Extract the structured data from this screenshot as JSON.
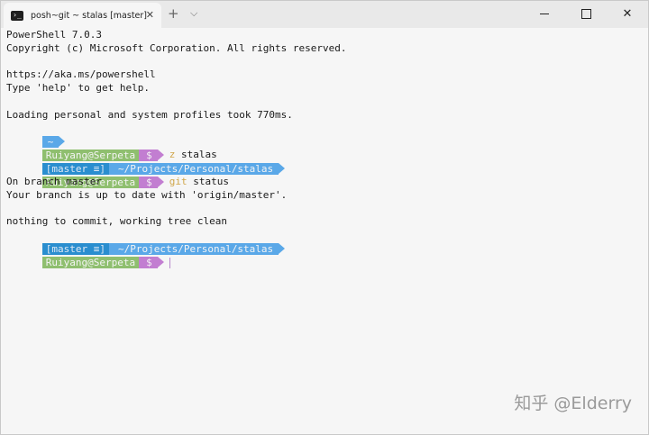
{
  "tab": {
    "icon_glyph": "›_",
    "title": "posh~git ~ stalas [master]",
    "close_glyph": "✕"
  },
  "titlebar": {
    "new_tab_glyph": "+",
    "dropdown_glyph": "⌵",
    "close_glyph": "✕"
  },
  "terminal": {
    "banner": [
      "PowerShell 7.0.3",
      "Copyright (c) Microsoft Corporation. All rights reserved.",
      "",
      "https://aka.ms/powershell",
      "Type 'help' to get help.",
      "",
      "Loading personal and system profiles took 770ms."
    ],
    "tilde_segment": "~",
    "prompt_user": "Ruiyang@Serpeta",
    "prompt_dollar": "$",
    "cmd1_word": "z",
    "cmd1_arg": "stalas",
    "branch_segment": "[master ≡]",
    "path_segment": "~/Projects/Personal/stalas",
    "cmd2_word": "git",
    "cmd2_arg": "status",
    "output": [
      "On branch master",
      "Your branch is up to date with 'origin/master'.",
      "",
      "nothing to commit, working tree clean"
    ]
  },
  "watermark": "知乎 @Elderry",
  "colors": {
    "user_segment": "#8fbf6f",
    "dollar_segment": "#c27ed1",
    "branch_segment": "#2a8ecf",
    "path_segment": "#5aa8e8",
    "command_word": "#d0a64a"
  }
}
